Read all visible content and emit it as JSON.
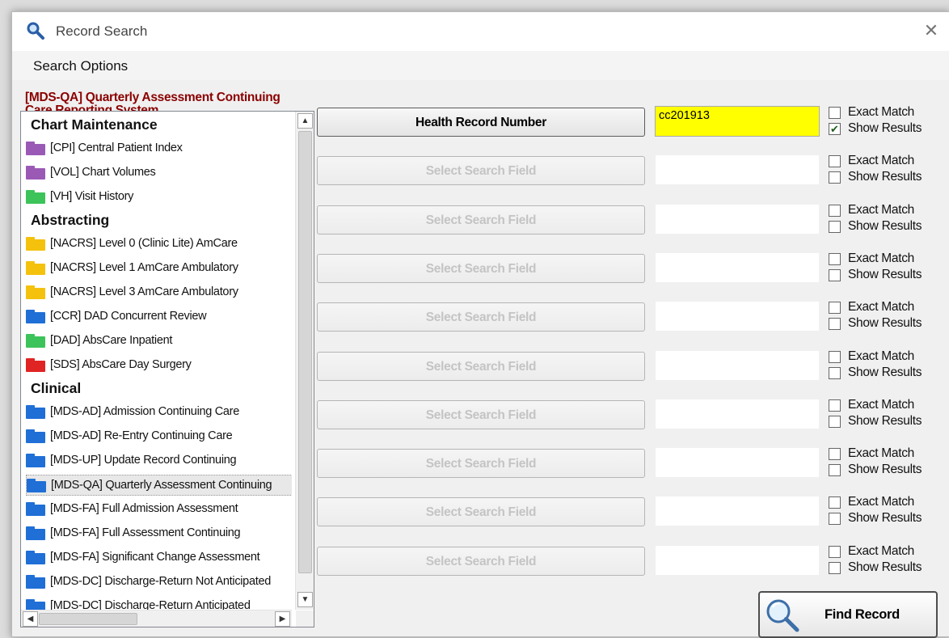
{
  "window": {
    "title": "Record Search",
    "close_glyph": "✕"
  },
  "menu": {
    "items": [
      "Search Options"
    ]
  },
  "selection": {
    "label": "[MDS-QA] Quarterly Assessment Continuing Care Reporting System"
  },
  "tree": {
    "groups": [
      {
        "title": "Chart Maintenance",
        "items": [
          {
            "label": "[CPI] Central Patient Index",
            "color": "#9b59b6"
          },
          {
            "label": "[VOL] Chart Volumes",
            "color": "#9b59b6"
          },
          {
            "label": "[VH] Visit History",
            "color": "#3cc35a"
          }
        ]
      },
      {
        "title": "Abstracting",
        "items": [
          {
            "label": "[NACRS] Level 0 (Clinic Lite) AmCare",
            "color": "#f4c20d"
          },
          {
            "label": "[NACRS] Level 1 AmCare Ambulatory",
            "color": "#f4c20d"
          },
          {
            "label": "[NACRS] Level 3 AmCare Ambulatory",
            "color": "#f4c20d"
          },
          {
            "label": "[CCR] DAD Concurrent Review",
            "color": "#1f6fd6"
          },
          {
            "label": "[DAD] AbsCare Inpatient",
            "color": "#3cc35a"
          },
          {
            "label": "[SDS] AbsCare Day Surgery",
            "color": "#e02424"
          }
        ]
      },
      {
        "title": "Clinical",
        "items": [
          {
            "label": "[MDS-AD] Admission Continuing Care",
            "color": "#1f6fd6"
          },
          {
            "label": "[MDS-AD] Re-Entry Continuing Care",
            "color": "#1f6fd6"
          },
          {
            "label": "[MDS-UP] Update Record Continuing",
            "color": "#1f6fd6"
          },
          {
            "label": "[MDS-QA] Quarterly Assessment Continuing",
            "color": "#1f6fd6",
            "selected": true
          },
          {
            "label": "[MDS-FA] Full Admission Assessment",
            "color": "#1f6fd6"
          },
          {
            "label": "[MDS-FA] Full Assessment Continuing",
            "color": "#1f6fd6"
          },
          {
            "label": "[MDS-FA] Significant Change Assessment",
            "color": "#1f6fd6"
          },
          {
            "label": "[MDS-DC] Discharge-Return Not Anticipated",
            "color": "#1f6fd6"
          },
          {
            "label": "[MDS-DC] Discharge-Return Anticipated",
            "color": "#1f6fd6"
          }
        ]
      }
    ]
  },
  "search_rows": [
    {
      "field": "Health Record Number",
      "enabled": true,
      "value": "cc201913",
      "exact_match": false,
      "show_results": true
    },
    {
      "field": "Select Search Field",
      "enabled": false,
      "value": "",
      "exact_match": false,
      "show_results": false
    },
    {
      "field": "Select Search Field",
      "enabled": false,
      "value": "",
      "exact_match": false,
      "show_results": false
    },
    {
      "field": "Select Search Field",
      "enabled": false,
      "value": "",
      "exact_match": false,
      "show_results": false
    },
    {
      "field": "Select Search Field",
      "enabled": false,
      "value": "",
      "exact_match": false,
      "show_results": false
    },
    {
      "field": "Select Search Field",
      "enabled": false,
      "value": "",
      "exact_match": false,
      "show_results": false
    },
    {
      "field": "Select Search Field",
      "enabled": false,
      "value": "",
      "exact_match": false,
      "show_results": false
    },
    {
      "field": "Select Search Field",
      "enabled": false,
      "value": "",
      "exact_match": false,
      "show_results": false
    },
    {
      "field": "Select Search Field",
      "enabled": false,
      "value": "",
      "exact_match": false,
      "show_results": false
    },
    {
      "field": "Select Search Field",
      "enabled": false,
      "value": "",
      "exact_match": false,
      "show_results": false
    }
  ],
  "labels": {
    "exact_match": "Exact Match",
    "show_results": "Show Results",
    "check_glyph": "✔"
  },
  "find_button": {
    "label": "Find Record",
    "icon": "magnifier-icon"
  },
  "icons": {
    "title": "search-icon",
    "close": "close-icon"
  }
}
